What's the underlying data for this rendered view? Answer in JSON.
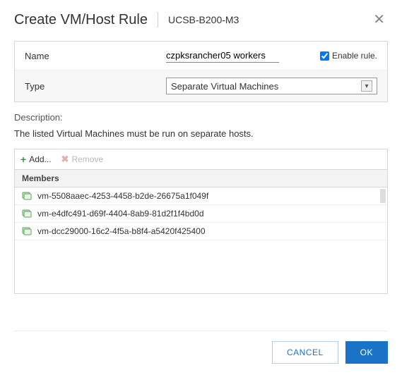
{
  "header": {
    "title": "Create VM/Host Rule",
    "context": "UCSB-B200-M3"
  },
  "form": {
    "name_label": "Name",
    "name_value": "czpksrancher05 workers",
    "enable_label": "Enable rule.",
    "enable_checked": true,
    "type_label": "Type",
    "type_value": "Separate Virtual Machines"
  },
  "description": {
    "label": "Description:",
    "text": "The listed Virtual Machines must be run on separate hosts."
  },
  "toolbar": {
    "add_label": "Add...",
    "remove_label": "Remove"
  },
  "members": {
    "header": "Members",
    "items": [
      "vm-5508aaec-4253-4458-b2de-26675a1f049f",
      "vm-e4dfc491-d69f-4404-8ab9-81d2f1f4bd0d",
      "vm-dcc29000-16c2-4f5a-b8f4-a5420f425400"
    ]
  },
  "buttons": {
    "cancel": "CANCEL",
    "ok": "OK"
  }
}
